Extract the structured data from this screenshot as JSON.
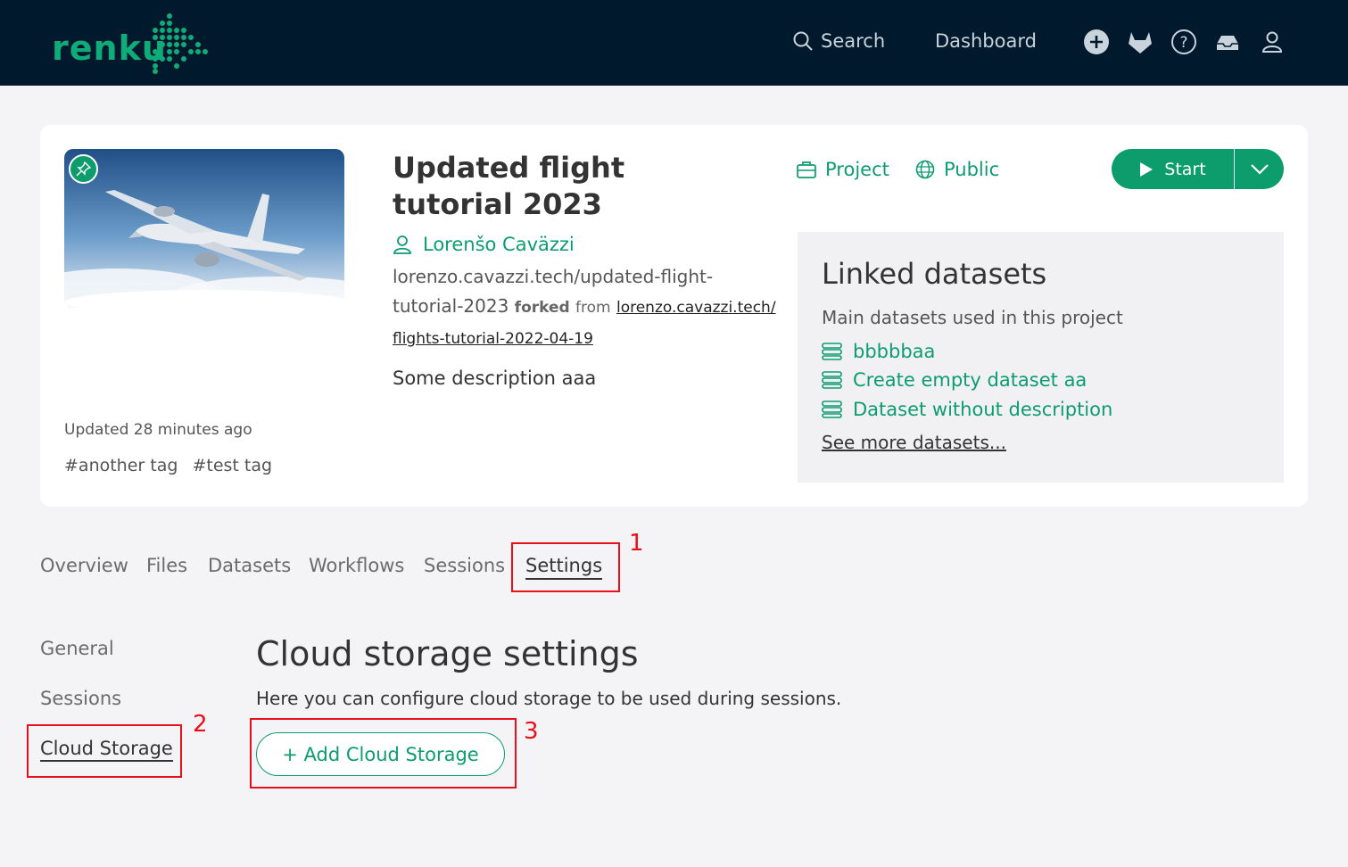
{
  "navbar": {
    "logo_text": "renku",
    "search_label": "Search",
    "dashboard_label": "Dashboard",
    "icons": [
      "plus-circle-icon",
      "gitlab-icon",
      "help-icon",
      "inbox-icon",
      "user-icon"
    ]
  },
  "project": {
    "title": "Updated flight tutorial 2023",
    "author": "Lorenšo Caväzzi",
    "slug": "lorenzo.cavazzi.tech/updated-flight-tutorial-2023",
    "forked_label": "forked",
    "from_label": "from",
    "fork_origin": "lorenzo.cavazzi.tech/ flights-tutorial-2022-04-19",
    "description": "Some description aaa",
    "updated": "Updated 28 minutes ago",
    "tags": [
      "#another tag",
      "#test tag"
    ],
    "type_label": "Project",
    "visibility_label": "Public",
    "start_label": "Start"
  },
  "linked_datasets": {
    "title": "Linked datasets",
    "subtitle": "Main datasets used in this project",
    "items": [
      "bbbbbaa",
      "Create empty dataset aa",
      "Dataset without description"
    ],
    "see_more": "See more datasets..."
  },
  "tabs": [
    "Overview",
    "Files",
    "Datasets",
    "Workflows",
    "Sessions",
    "Settings"
  ],
  "active_tab": "Settings",
  "settings_nav": [
    "General",
    "Sessions",
    "Cloud Storage"
  ],
  "active_settings": "Cloud Storage",
  "cloud_storage": {
    "title": "Cloud storage settings",
    "subtitle": "Here you can configure cloud storage to be used during sessions.",
    "add_button": "+ Add Cloud Storage"
  },
  "annotations": [
    "1",
    "2",
    "3"
  ],
  "colors": {
    "navbar": "#01192d",
    "accent": "#0d9d6c",
    "annotation": "#e8101a"
  }
}
